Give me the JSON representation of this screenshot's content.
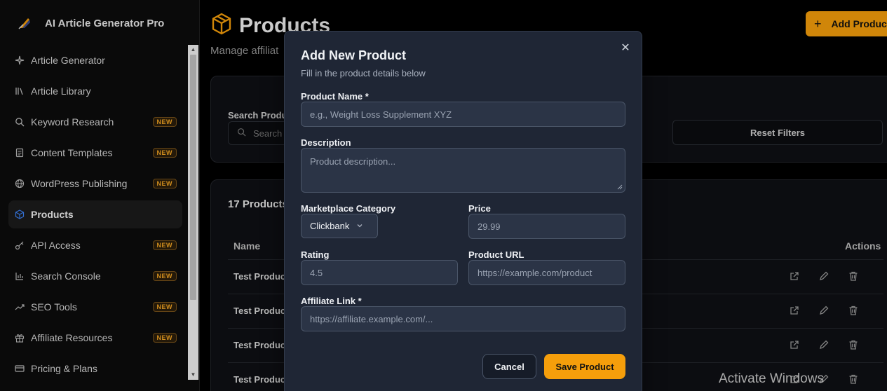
{
  "sidebar": {
    "brand_title": "AI Article Generator Pro",
    "items": [
      {
        "label": "Article Generator",
        "icon": "sparkle-icon",
        "badge": ""
      },
      {
        "label": "Article Library",
        "icon": "library-icon",
        "badge": ""
      },
      {
        "label": "Keyword Research",
        "icon": "search-icon",
        "badge": "NEW"
      },
      {
        "label": "Content Templates",
        "icon": "file-icon",
        "badge": "NEW"
      },
      {
        "label": "WordPress Publishing",
        "icon": "globe-icon",
        "badge": "NEW"
      },
      {
        "label": "Products",
        "icon": "cube-icon",
        "badge": "",
        "active": true
      },
      {
        "label": "API Access",
        "icon": "key-icon",
        "badge": "NEW"
      },
      {
        "label": "Search Console",
        "icon": "bar-chart-icon",
        "badge": "NEW"
      },
      {
        "label": "SEO Tools",
        "icon": "trend-icon",
        "badge": "NEW"
      },
      {
        "label": "Affiliate Resources",
        "icon": "gift-icon",
        "badge": "NEW"
      },
      {
        "label": "Pricing & Plans",
        "icon": "card-icon",
        "badge": ""
      }
    ]
  },
  "main": {
    "title": "Products",
    "subtitle": "Manage affiliat",
    "add_button": "Add Produc",
    "search_label": "Search Produ",
    "search_placeholder": "Search",
    "reset_button": "Reset Filters",
    "count_title": "17 Products",
    "columns": {
      "name": "Name",
      "actions": "Actions"
    },
    "rows": [
      "Test Produc",
      "Test Produc",
      "Test Produc",
      "Test Produc"
    ]
  },
  "modal": {
    "title": "Add New Product",
    "subtitle": "Fill in the product details below",
    "fields": {
      "name_label": "Product Name *",
      "name_placeholder": "e.g., Weight Loss Supplement XYZ",
      "desc_label": "Description",
      "desc_placeholder": "Product description...",
      "category_label": "Marketplace Category",
      "category_value": "Clickbank",
      "price_label": "Price",
      "price_placeholder": "29.99",
      "rating_label": "Rating",
      "rating_placeholder": "4.5",
      "url_label": "Product URL",
      "url_placeholder": "https://example.com/product",
      "affiliate_label": "Affiliate Link *",
      "affiliate_placeholder": "https://affiliate.example.com/..."
    },
    "cancel_button": "Cancel",
    "save_button": "Save Product"
  },
  "os_watermark": "Activate Windows",
  "colors": {
    "accent": "#f59e0b",
    "modal_bg": "#1f2635",
    "badge_text": "#f5a623"
  }
}
